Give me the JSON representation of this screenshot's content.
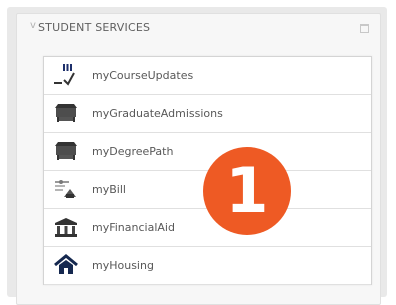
{
  "panel": {
    "caret": "v",
    "title": "STUDENT SERVICES"
  },
  "items": [
    {
      "label": "myCourseUpdates",
      "icon": "course-updates-icon"
    },
    {
      "label": "myGraduateAdmissions",
      "icon": "graduate-admissions-icon"
    },
    {
      "label": "myDegreePath",
      "icon": "degree-path-icon"
    },
    {
      "label": "myBill",
      "icon": "bill-icon"
    },
    {
      "label": "myFinancialAid",
      "icon": "financial-aid-icon"
    },
    {
      "label": "myHousing",
      "icon": "housing-icon"
    }
  ],
  "callout": {
    "number": "1",
    "color": "#ee5a24"
  }
}
